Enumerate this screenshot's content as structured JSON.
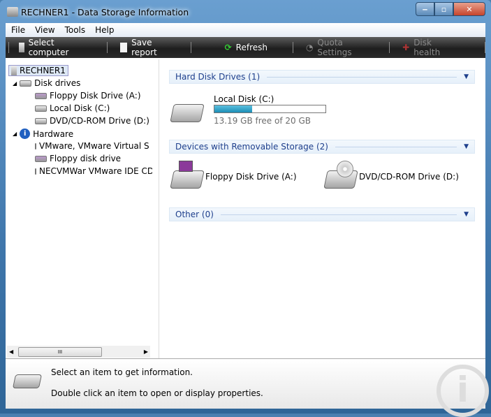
{
  "window": {
    "title": "RECHNER1 - Data Storage Information"
  },
  "menu": [
    "File",
    "View",
    "Tools",
    "Help"
  ],
  "toolbar": {
    "select_computer": "Select computer",
    "save_report": "Save report",
    "refresh": "Refresh",
    "quota_settings": "Quota Settings",
    "disk_health": "Disk health"
  },
  "tree": {
    "root": "RECHNER1",
    "disk_drives": "Disk drives",
    "disks": [
      "Floppy Disk Drive (A:)",
      "Local Disk (C:)",
      "DVD/CD-ROM Drive (D:)"
    ],
    "hardware": "Hardware",
    "hw": [
      "VMware, VMware Virtual S S",
      "Floppy disk drive",
      "NECVMWar VMware IDE CD"
    ]
  },
  "scrollbar": {
    "grip": "III"
  },
  "groups": {
    "hdd": "Hard Disk Drives (1)",
    "removable": "Devices with Removable Storage (2)",
    "other": "Other (0)"
  },
  "local_disk": {
    "name": "Local Disk (C:)",
    "free": "13.19 GB free of 20 GB",
    "used_fraction": 0.34
  },
  "removable": {
    "floppy": "Floppy Disk Drive (A:)",
    "dvd": "DVD/CD-ROM Drive (D:)"
  },
  "status": {
    "line1": "Select an item to get information.",
    "line2": "Double click an item to open or display properties."
  },
  "colors": {
    "accent": "#1e3f8c",
    "bar": "#1c8db5"
  }
}
